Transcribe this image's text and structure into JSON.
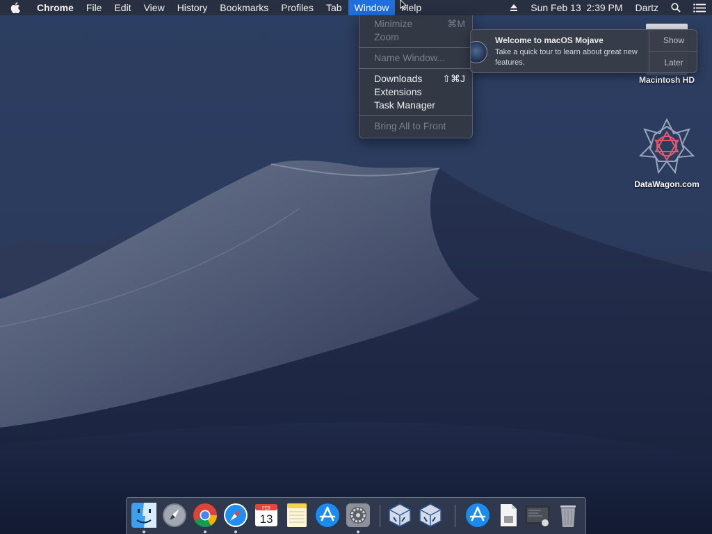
{
  "menubar": {
    "app_name": "Chrome",
    "menus": [
      "File",
      "Edit",
      "View",
      "History",
      "Bookmarks",
      "Profiles",
      "Tab",
      "Window",
      "Help"
    ],
    "active_menu": "Window",
    "clock": "Sun Feb 13  2:39 PM",
    "user": "Dartz",
    "icons": [
      "apple-icon",
      "eject-icon",
      "spotlight-search-icon",
      "notification-center-icon"
    ]
  },
  "window_menu": {
    "items": [
      {
        "label": "Minimize",
        "shortcut": "⌘M",
        "enabled": false
      },
      {
        "label": "Zoom",
        "shortcut": "",
        "enabled": false
      },
      {
        "label": "Name Window...",
        "shortcut": "",
        "enabled": false
      },
      {
        "label": "Downloads",
        "shortcut": "⇧⌘J",
        "enabled": true
      },
      {
        "label": "Extensions",
        "shortcut": "",
        "enabled": true
      },
      {
        "label": "Task Manager",
        "shortcut": "",
        "enabled": true
      },
      {
        "label": "Bring All to Front",
        "shortcut": "",
        "enabled": false
      }
    ]
  },
  "notification": {
    "title": "Welcome to macOS Mojave",
    "body": "Take a quick tour to learn about great new features.",
    "show_label": "Show",
    "later_label": "Later"
  },
  "desktop_icons": {
    "hd_label": "Macintosh HD",
    "datawagon_label": "DataWagon.com"
  },
  "dock": {
    "calendar_month": "FEB",
    "calendar_day": "13",
    "apps": [
      "finder-icon",
      "launchpad-icon",
      "chrome-icon",
      "safari-icon",
      "calendar-icon",
      "notes-icon",
      "app-store-icon",
      "system-preferences-icon",
      "virtualbox-icon",
      "virtualbox-icon",
      "app-store-folder-icon",
      "document-icon",
      "screenshot-icon",
      "trash-icon"
    ]
  },
  "colors": {
    "menu_highlight": "#1f6fe0",
    "menu_bg": "#343844",
    "wallpaper_sky": "#2b3c5e"
  }
}
